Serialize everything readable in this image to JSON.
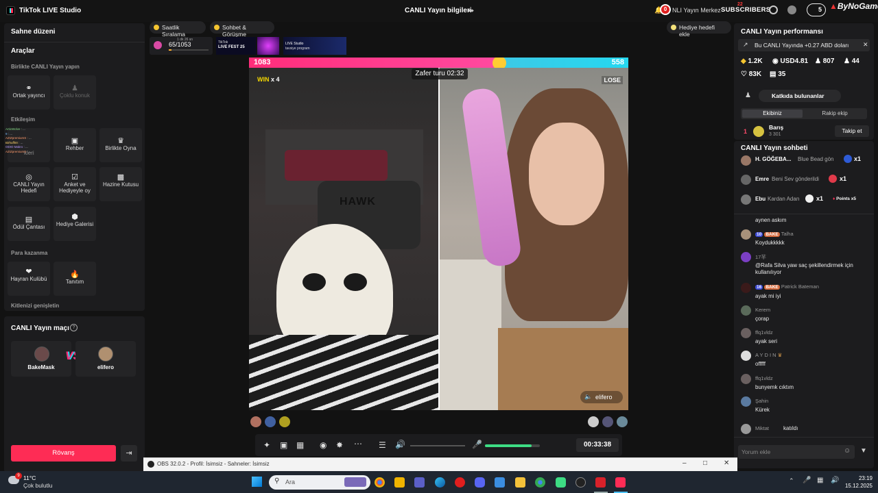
{
  "app": {
    "title": "TikTok LIVE Studio",
    "live_info_title": "CANLI Yayın bilgileri"
  },
  "topright": {
    "notif_count": "0",
    "center_label": "NLI Yayın Merkez",
    "subscribers_label": "SUBSCRIBERS",
    "subs_count": "5",
    "red_badge": "22",
    "channel_label": "ByNoGame"
  },
  "left_panel": {
    "scene_title": "Sahne düzeni",
    "tools_title": "Araçlar",
    "together_title": "Birlikte CANLI Yayın yapın",
    "cohost_label": "Ortak yayıncı",
    "multi_guest_label": "Çoklu konuk",
    "engagement_title": "Etkileşim",
    "guide_label": "Rehber",
    "play_together_label": "Birlikte Oyna",
    "live_goal_label": "CANLI Yayın Hedefi",
    "poll_label": "Anket ve Hediyeyle oy",
    "treasure_label": "Hazine Kutusu",
    "reward_bag_label": "Ödül Çantası",
    "gift_gallery_label": "Hediye Galerisi",
    "monetize_title": "Para kazanma",
    "fan_club_label": "Hayran Kulübü",
    "promo_label": "Tanıtım",
    "audience_title": "Kitlenizi genişletin",
    "under_engagement_label": "kleri",
    "match_title": "CANLI Yayın maçı",
    "player1": "BakeMask",
    "player2": "elifero",
    "vs": "VS",
    "rematch_label": "Rövanş"
  },
  "overlay_chat_names": [
    "ArticWolve :",
    "9 :",
    "AZIZpremiumS :",
    "Birhuff00 :",
    "ODIO Makro :",
    "AZIZpremiumS :"
  ],
  "stage": {
    "hourly_rank_label": "Saatlik Sıralama",
    "chat_meet_label": "Sohbet & Görüşme",
    "add_gift_goal_label": "Hediye hedefi ekle",
    "goal_progress_text": "65/1053",
    "goal_sub_text": "1 dk 26 sn",
    "fest_label_1": "TikTok",
    "fest_label_2": "LIVE FEST 25",
    "studio_promo_1": "LIVE Studio",
    "studio_promo_2": "tavsiye program"
  },
  "battle": {
    "left_score": "1083",
    "right_score": "558",
    "left_fraction": 0.66,
    "timer_label": "Zafer turu 02:32",
    "win_label": "WIN",
    "win_mult": "x 4",
    "lose_label": "LOSE",
    "right_user": "elifero",
    "left_hat_text": "HAWK"
  },
  "controls": {
    "timer": "00:33:38",
    "mic_level": 0.85
  },
  "right_panel": {
    "perf_title": "CANLI Yayın performansı",
    "earn_notice": "Bu CANLI Yayında +0.27 ABD doları",
    "stat_views": "1.2K",
    "stat_usd": "USD4.81",
    "stat_viewers": "807",
    "stat_new": "44",
    "stat_likes": "83K",
    "stat_gifts": "35",
    "contributors_label": "Katkıda bulunanlar",
    "tab_team": "Ekibiniz",
    "tab_rival": "Rakip ekip",
    "top_rank": "1",
    "top_user": "Barış",
    "top_user_stats": "3  301",
    "follow_label": "Takip et"
  },
  "chat": {
    "title": "CANLI Yayın sohbeti",
    "gifts": [
      {
        "name": "H. GÖĞEBA...",
        "text": "Blue Bead gön",
        "count": "x1"
      },
      {
        "name": "Emre",
        "text": "Beni Sev gönderildi",
        "count": "x1"
      },
      {
        "name": "Ebu",
        "text": "Kardan Adan",
        "count": "x1",
        "points": "Points x5"
      }
    ],
    "messages": [
      {
        "name": "",
        "text": "aynen askım"
      },
      {
        "name": "Talha",
        "lvl": "10",
        "bake": "BAKE",
        "text": "Koydukkkkk"
      },
      {
        "name": "17羋",
        "text": "@Rafa Silva yaw saç şekillendirmek için kullanılıyor"
      },
      {
        "name": "Patrick Bateman",
        "lvl": "16",
        "bake": "BAKE",
        "text": "ayak mi iyi"
      },
      {
        "name": "Kerem",
        "text": "çorap"
      },
      {
        "name": "ffq1vldz",
        "text": "ayak seri"
      },
      {
        "name": "A Y D I N",
        "text": "offfff"
      },
      {
        "name": "ffq1vldz",
        "text": "bunyemk cıktım"
      },
      {
        "name": "Şahin",
        "text": "Kürek"
      },
      {
        "name": "Miktat",
        "text": "katıldı"
      }
    ],
    "input_placeholder": "Yorum ekle"
  },
  "obs": {
    "title": "OBS 32.0.2 - Profil: İsimsiz - Sahneler: İsimsiz"
  },
  "taskbar": {
    "weather_temp": "11°C",
    "weather_desc": "Çok bulutlu",
    "weather_badge": "9",
    "search_placeholder": "Ara",
    "time": "23:19",
    "date": "15.12.2025"
  }
}
